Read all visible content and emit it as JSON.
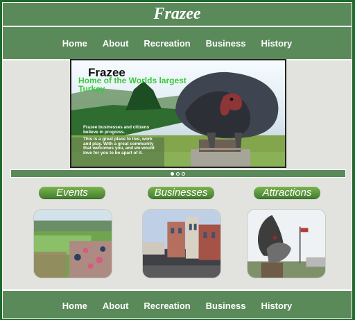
{
  "site": {
    "title": "Frazee"
  },
  "nav": [
    "Home",
    "About",
    "Recreation",
    "Business",
    "History"
  ],
  "hero": {
    "title": "Frazee",
    "subtitle": "Home of the Worlds largest Turkey",
    "paragraph1": "Frazee businesses and citizens believe in progress.",
    "paragraph2": "This is a great place to live, work and play. With a great community that welcomes you, and we would love for you to be apart of it."
  },
  "categories": [
    "Events",
    "Businesses",
    "Attractions"
  ],
  "colors": {
    "frame_green": "#1f6a2c",
    "bar_green": "#5b8a5a",
    "button_green": "#5a9a3f",
    "accent_text": "#39c93b"
  }
}
